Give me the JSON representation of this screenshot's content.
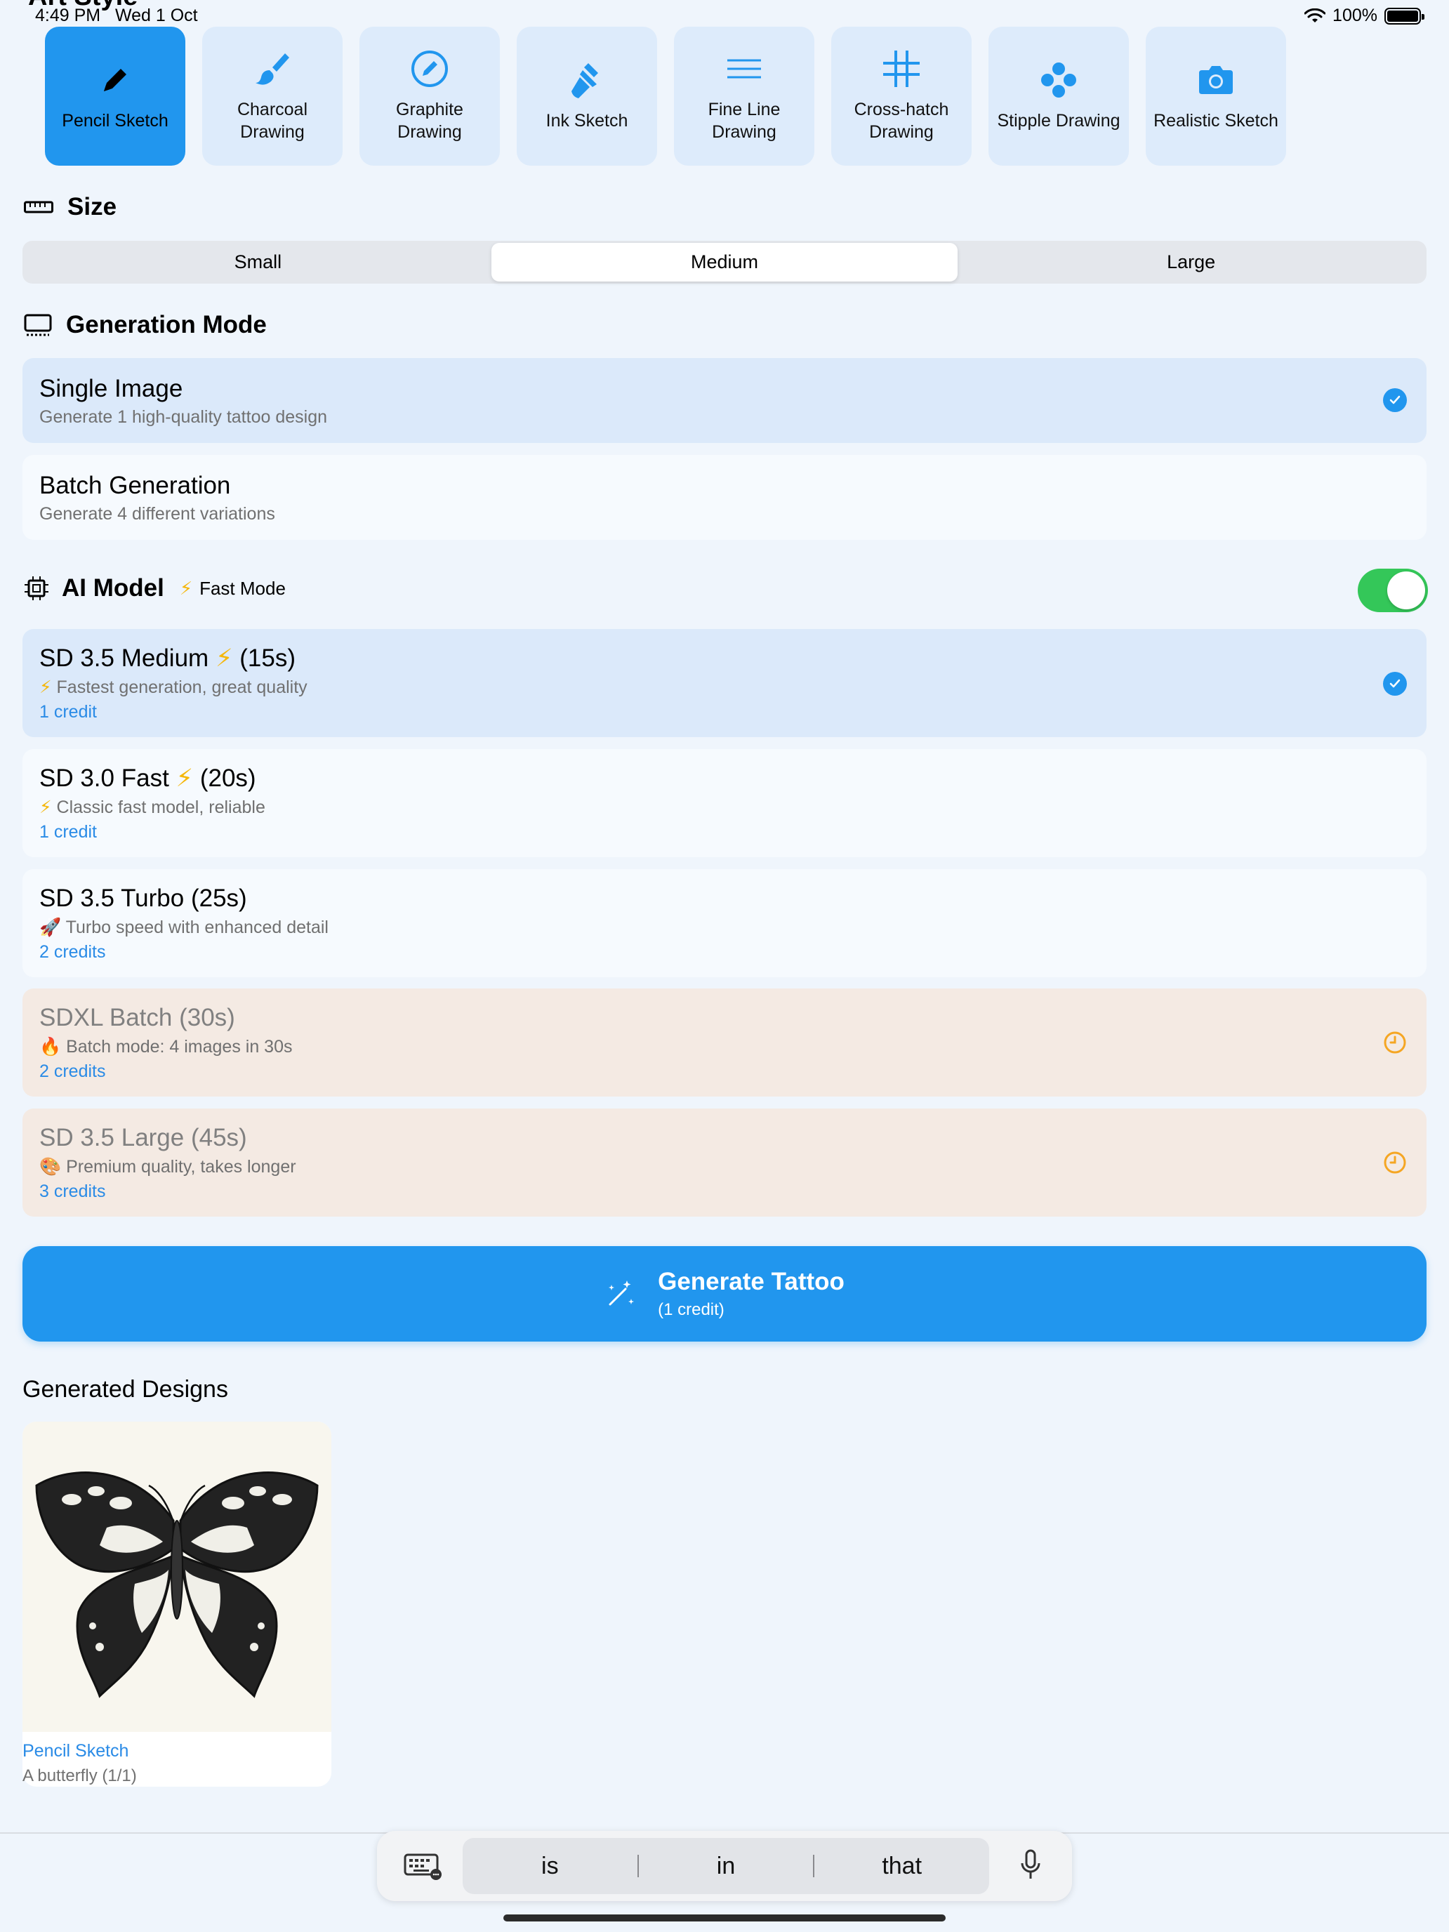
{
  "status_bar": {
    "time": "4:49 PM",
    "date": "Wed 1 Oct",
    "battery": "100%",
    "partial_title": "Art Style"
  },
  "styles": [
    {
      "label": "Pencil Sketch",
      "icon": "pencil-icon",
      "selected": true
    },
    {
      "label": "Charcoal Drawing",
      "icon": "brush-icon",
      "selected": false
    },
    {
      "label": "Graphite Drawing",
      "icon": "pencil-circle-icon",
      "selected": false
    },
    {
      "label": "Ink Sketch",
      "icon": "paintbrush-pointed-icon",
      "selected": false
    },
    {
      "label": "Fine Line Drawing",
      "icon": "lines-icon",
      "selected": false
    },
    {
      "label": "Cross-hatch Drawing",
      "icon": "grid-icon",
      "selected": false
    },
    {
      "label": "Stipple Drawing",
      "icon": "dots-icon",
      "selected": false
    },
    {
      "label": "Realistic Sketch",
      "icon": "camera-icon",
      "selected": false
    }
  ],
  "size": {
    "title": "Size",
    "options": [
      "Small",
      "Medium",
      "Large"
    ],
    "selected": "Medium"
  },
  "generation_mode": {
    "title": "Generation Mode",
    "options": [
      {
        "title": "Single Image",
        "subtitle": "Generate 1 high-quality tattoo design",
        "selected": true
      },
      {
        "title": "Batch Generation",
        "subtitle": "Generate 4 different variations",
        "selected": false
      }
    ]
  },
  "ai_model": {
    "title": "AI Model",
    "fast_mode_label": "Fast Mode",
    "fast_mode_on": true,
    "models": [
      {
        "name": "SD 3.5 Medium",
        "bolt": "⚡",
        "time": "(15s)",
        "emoji": "⚡",
        "desc": "Fastest generation, great quality",
        "credits": "1 credit",
        "state": "selected"
      },
      {
        "name": "SD 3.0 Fast",
        "bolt": "⚡",
        "time": "(20s)",
        "emoji": "⚡",
        "desc": "Classic fast model, reliable",
        "credits": "1 credit",
        "state": "normal"
      },
      {
        "name": "SD 3.5 Turbo (25s)",
        "emoji": "🚀",
        "desc": "Turbo speed with enhanced detail",
        "credits": "2 credits",
        "state": "normal"
      },
      {
        "name": "SDXL Batch (30s)",
        "emoji": "🔥",
        "desc": "Batch mode: 4 images in 30s",
        "credits": "2 credits",
        "state": "disabled"
      },
      {
        "name": "SD 3.5 Large (45s)",
        "emoji": "🎨",
        "desc": "Premium quality, takes longer",
        "credits": "3 credits",
        "state": "disabled"
      }
    ]
  },
  "generate_button": {
    "label": "Generate Tattoo",
    "sublabel": "(1 credit)"
  },
  "generated": {
    "title": "Generated Designs",
    "items": [
      {
        "style": "Pencil Sketch",
        "prompt": "A butterfly  (1/1)"
      }
    ]
  },
  "keyboard": {
    "suggestions": [
      "is",
      "in",
      "that"
    ]
  },
  "colors": {
    "accent": "#2196EE",
    "selected_bg": "#DBE9FA",
    "disabled_bg": "#F4EAE3",
    "toggle_on": "#34C759",
    "warning": "#F5A623"
  }
}
